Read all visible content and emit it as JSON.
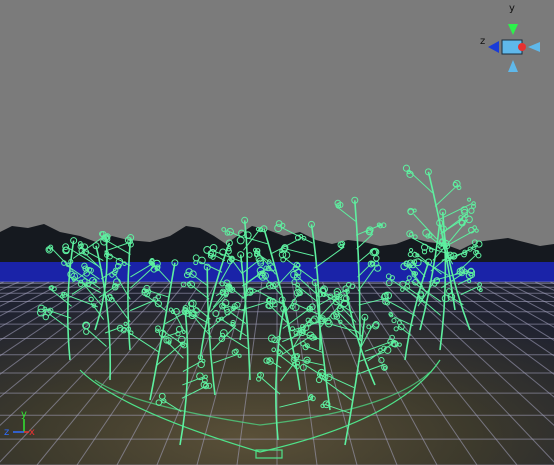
{
  "viewport": {
    "sky_color": "#7b7b7b",
    "mountain_color": "#15191f",
    "horizon_color": "#1a23a8",
    "ground_color": "#3b3a30",
    "grid_color": "#a8a6c2",
    "plant_color": "#5ef0a0",
    "selection_ring_color": "#4fe38a"
  },
  "viewcube": {
    "axis_y": "y",
    "axis_z": "z",
    "axis_y_color": "#2cf24a",
    "axis_z_color": "#1a3cd8",
    "axis_x_color": "#e83030",
    "body_color": "#5fb8ea"
  },
  "triad": {
    "axis_y": "y",
    "axis_z": "z",
    "axis_x": "x",
    "axis_y_color": "#32e832",
    "axis_z_color": "#2f6cff",
    "axis_x_color": "#e83232"
  }
}
